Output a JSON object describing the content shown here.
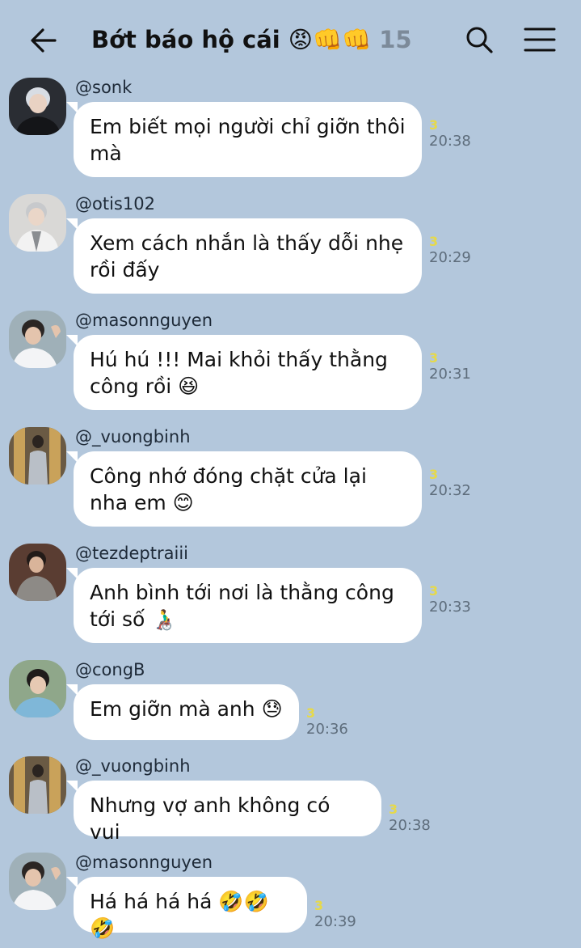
{
  "header": {
    "title": "Bớt báo hộ cái 😡👊👊",
    "member_count": "15",
    "back_icon": "arrow-left-icon",
    "search_icon": "search-icon",
    "menu_icon": "hamburger-menu-icon"
  },
  "messages": [
    {
      "user": "@sonk",
      "text": "Em biết mọi người chỉ giỡn thôi mà",
      "seen": "3",
      "time": "20:38"
    },
    {
      "user": "@otis102",
      "text": "Xem cách nhắn là thấy dỗi nhẹ rồi đấy",
      "seen": "3",
      "time": "20:29"
    },
    {
      "user": "@masonnguyen",
      "text": "Hú hú !!! Mai khỏi thấy thằng công rồi 😆",
      "seen": "3",
      "time": "20:31"
    },
    {
      "user": "@_vuongbinh",
      "text": "Công nhớ đóng chặt cửa lại nha em 😊",
      "seen": "3",
      "time": "20:32"
    },
    {
      "user": "@tezdeptraiii",
      "text": "Anh bình tới nơi là thằng công tới số 👨‍🦽",
      "seen": "3",
      "time": "20:33"
    },
    {
      "user": "@congB",
      "text": "Em giỡn mà anh 😓",
      "seen": "3",
      "time": "20:36"
    },
    {
      "user": "@_vuongbinh",
      "text": "Nhưng vợ anh không có vui",
      "seen": "3",
      "time": "20:38"
    },
    {
      "user": "@masonnguyen",
      "text": "Há há há há 🤣🤣🤣",
      "seen": "3",
      "time": "20:39"
    }
  ]
}
